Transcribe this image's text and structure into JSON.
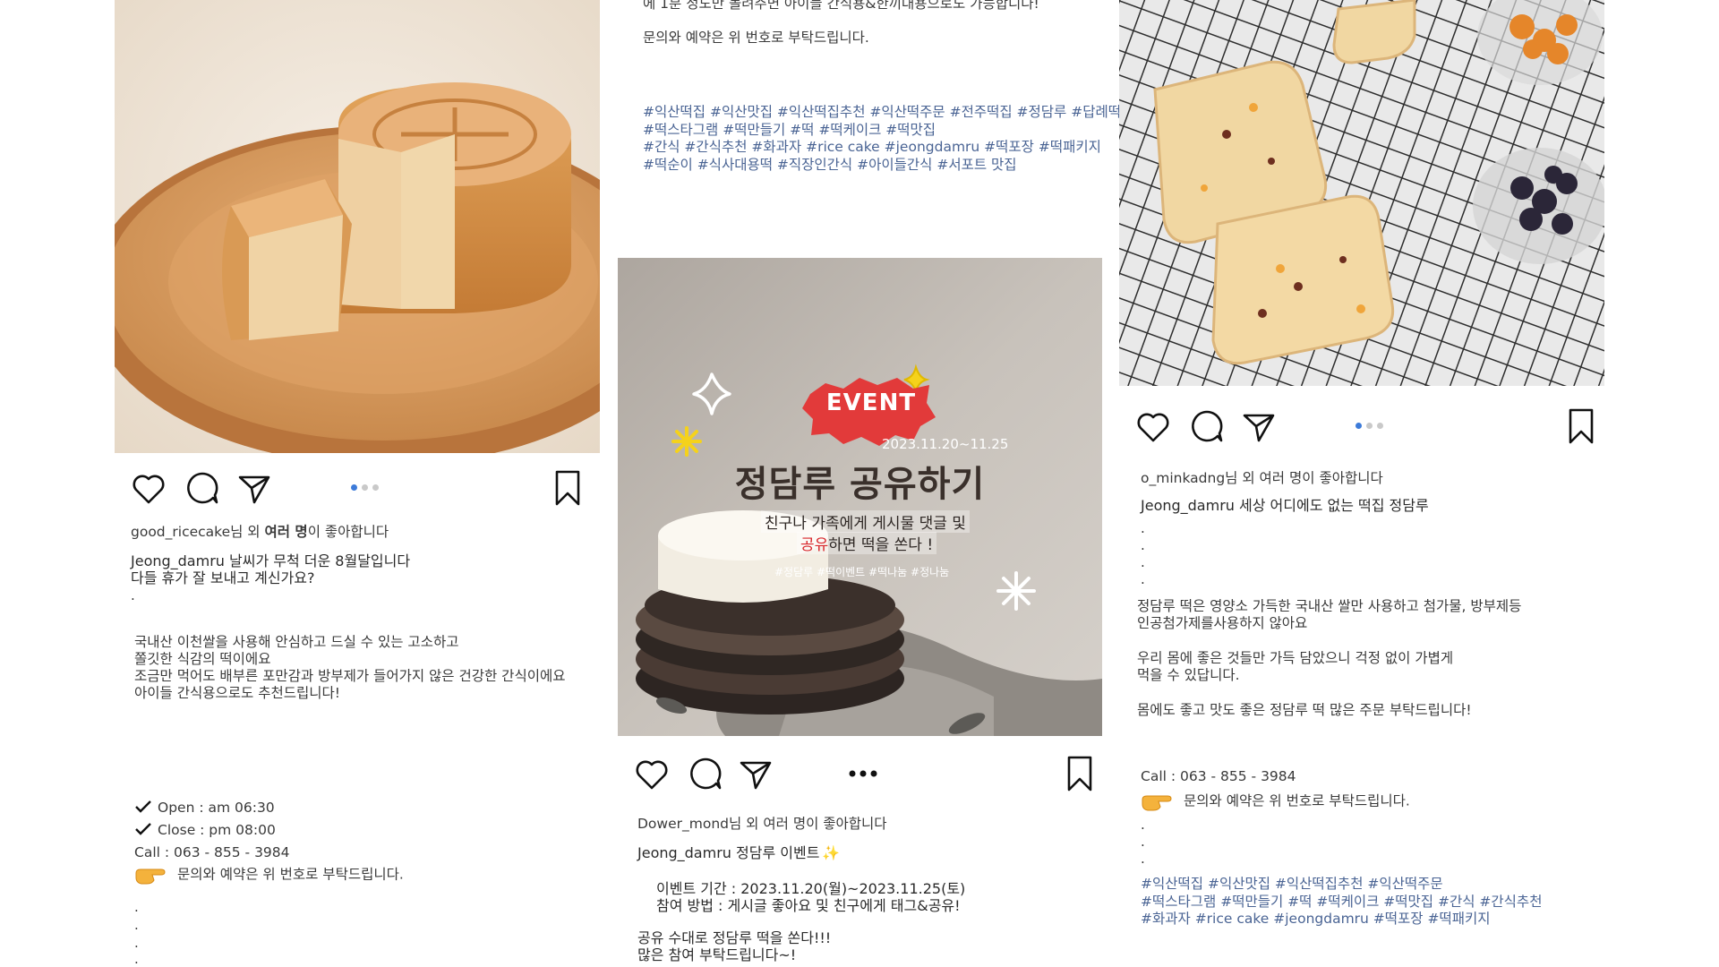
{
  "post1": {
    "likes_user": "good_ricecake",
    "likes_suffix": "님 외 ",
    "likes_bold": "여러 명",
    "likes_end": "이 좋아합니다",
    "caption_user": "Jeong_damru",
    "caption_line1": " 날씨가 무척 더운 8월달입니다",
    "caption_line2": "다들 휴가 잘 보내고 계신가요?",
    "dot": ".",
    "body": [
      "국내산 이천쌀을 사용해 안심하고 드실 수 있는 고소하고",
      "쫄깃한 식감의 떡이에요",
      "조금만 먹어도 배부른 포만감과 방부제가 들어가지 않은 건강한 간식이에요",
      "아이들 간식용으로도 추천드립니다!"
    ],
    "open": "Open : am 06:30",
    "close": "Close : pm 08:00",
    "call": "Call : 063 - 855 - 3984",
    "inquiry": "문의와 예약은 위 번호로 부탁드립니다.",
    "trailing_dots": [
      ".",
      ".",
      ".",
      "."
    ]
  },
  "post2": {
    "top_line1": "에 1분 정도만 돌려주면 아이들 간식용&한끼대용으로도 가능합니다!",
    "top_line2": "문의와 예약은 위 번호로 부탁드립니다.",
    "hashtags": [
      "#익산떡집 #익산맛집 #익산떡집추천 #익산떡주문 #전주떡집 #정담루 #답례떡",
      "#떡스타그램 #떡만들기 #떡 #떡케이크 #떡맛집",
      "#간식 #간식추천 #화과자 #rice cake #jeongdamru #떡포장 #떡패키지",
      "#떡순이 #식사대용떡 #직장인간식 #아이들간식 #서포트 맛집"
    ],
    "event_badge": "EVENT",
    "event_dates": "2023.11.20~11.25",
    "event_title": "정담루 공유하기",
    "event_sub1": "친구나 가족에게 게시물 댓글 및",
    "event_sub2_hl": "공유",
    "event_sub2_rest": "하면 떡을 쏜다 !",
    "event_tags": "#정담루 #떡이벤트 #떡나눔 #정나눔",
    "likes_user": "Dower_mond",
    "likes_suffix": "님 외 여러 명이 좋아합니다",
    "caption_user": "Jeong_damru",
    "caption_text": " 정담루 이벤트",
    "period": "이벤트 기간 : 2023.11.20(월)~2023.11.25(토)",
    "method": "참여 방법 : 게시글 좋아요 및 친구에게 태그&공유!",
    "closing1": "공유 수대로 정담루 떡을 쏜다!!!",
    "closing2": "많은 참여 부탁드립니다~!"
  },
  "post3": {
    "likes_user": "o_minkadng",
    "likes_suffix": "님 외 여러 명이 좋아합니다",
    "caption_user": "Jeong_damru",
    "caption_text": " 세상 어디에도 없는 떡집 정담루",
    "dots": [
      ".",
      ".",
      ".",
      "."
    ],
    "body1": "정담루 떡은 영양소 가득한 국내산 쌀만 사용하고 첨가물, 방부제등",
    "body2": "인공첨가제를사용하지 않아요",
    "body3": "우리 몸에 좋은 것들만 가득 담았으니 걱정 없이 가볍게",
    "body4": "먹을 수 있답니다.",
    "body5": "몸에도 좋고 맛도 좋은 정담루 떡 많은 주문 부탁드립니다!",
    "call": "Call : 063 - 855 - 3984",
    "inquiry": "문의와 예약은 위 번호로 부탁드립니다.",
    "dots2": [
      ".",
      ".",
      "."
    ],
    "hashtags": [
      "#익산떡집 #익산맛집 #익산떡집추천 #익산떡주문",
      "#떡스타그램 #떡만들기 #떡 #떡케이크 #떡맛집 #간식 #간식추천",
      "#화과자 #rice cake #jeongdamru #떡포장 #떡패키지"
    ]
  },
  "colors": {
    "hashtag": "#4a6494",
    "dot_active": "#3d7bd9",
    "event_badge": "#e23a3a"
  }
}
